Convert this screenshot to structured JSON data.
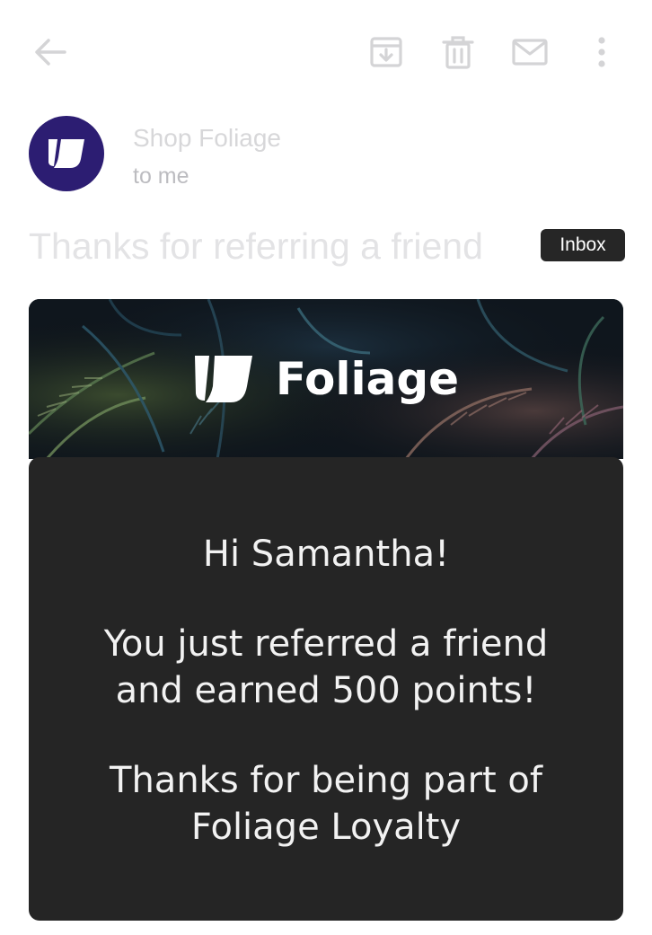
{
  "toolbar": {
    "back_icon": "arrow-left-icon",
    "archive_icon": "archive-icon",
    "delete_icon": "trash-icon",
    "mail_icon": "mail-icon",
    "more_icon": "more-vertical-icon",
    "icon_color": "#d4d4d6"
  },
  "sender": {
    "name": "Shop Foliage",
    "to": "to me",
    "avatar_color": "#2c1d72"
  },
  "subject": {
    "text": "Thanks for referring a friend",
    "badge": "Inbox"
  },
  "banner": {
    "brand_name": "Foliage"
  },
  "email_body": {
    "greeting": "Hi Samantha!",
    "line1": "You just referred a friend",
    "line2": "and earned 500 points!",
    "line3": "Thanks for being part of",
    "line4": "Foliage Loyalty",
    "card_color": "#252525"
  }
}
